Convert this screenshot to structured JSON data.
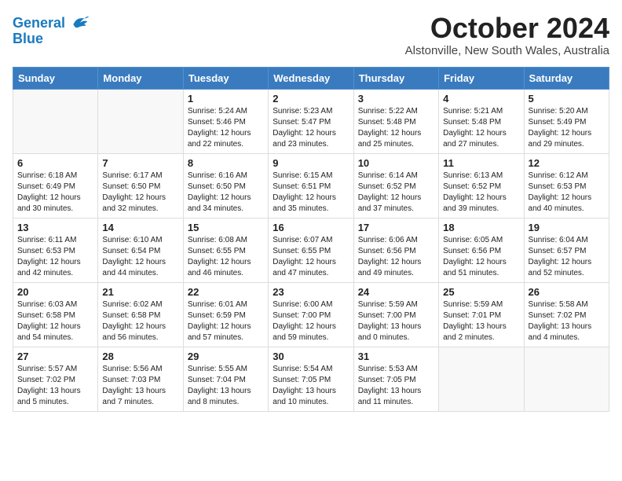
{
  "logo": {
    "line1": "General",
    "line2": "Blue"
  },
  "title": "October 2024",
  "subtitle": "Alstonville, New South Wales, Australia",
  "weekdays": [
    "Sunday",
    "Monday",
    "Tuesday",
    "Wednesday",
    "Thursday",
    "Friday",
    "Saturday"
  ],
  "weeks": [
    [
      {
        "day": "",
        "info": ""
      },
      {
        "day": "",
        "info": ""
      },
      {
        "day": "1",
        "info": "Sunrise: 5:24 AM\nSunset: 5:46 PM\nDaylight: 12 hours\nand 22 minutes."
      },
      {
        "day": "2",
        "info": "Sunrise: 5:23 AM\nSunset: 5:47 PM\nDaylight: 12 hours\nand 23 minutes."
      },
      {
        "day": "3",
        "info": "Sunrise: 5:22 AM\nSunset: 5:48 PM\nDaylight: 12 hours\nand 25 minutes."
      },
      {
        "day": "4",
        "info": "Sunrise: 5:21 AM\nSunset: 5:48 PM\nDaylight: 12 hours\nand 27 minutes."
      },
      {
        "day": "5",
        "info": "Sunrise: 5:20 AM\nSunset: 5:49 PM\nDaylight: 12 hours\nand 29 minutes."
      }
    ],
    [
      {
        "day": "6",
        "info": "Sunrise: 6:18 AM\nSunset: 6:49 PM\nDaylight: 12 hours\nand 30 minutes."
      },
      {
        "day": "7",
        "info": "Sunrise: 6:17 AM\nSunset: 6:50 PM\nDaylight: 12 hours\nand 32 minutes."
      },
      {
        "day": "8",
        "info": "Sunrise: 6:16 AM\nSunset: 6:50 PM\nDaylight: 12 hours\nand 34 minutes."
      },
      {
        "day": "9",
        "info": "Sunrise: 6:15 AM\nSunset: 6:51 PM\nDaylight: 12 hours\nand 35 minutes."
      },
      {
        "day": "10",
        "info": "Sunrise: 6:14 AM\nSunset: 6:52 PM\nDaylight: 12 hours\nand 37 minutes."
      },
      {
        "day": "11",
        "info": "Sunrise: 6:13 AM\nSunset: 6:52 PM\nDaylight: 12 hours\nand 39 minutes."
      },
      {
        "day": "12",
        "info": "Sunrise: 6:12 AM\nSunset: 6:53 PM\nDaylight: 12 hours\nand 40 minutes."
      }
    ],
    [
      {
        "day": "13",
        "info": "Sunrise: 6:11 AM\nSunset: 6:53 PM\nDaylight: 12 hours\nand 42 minutes."
      },
      {
        "day": "14",
        "info": "Sunrise: 6:10 AM\nSunset: 6:54 PM\nDaylight: 12 hours\nand 44 minutes."
      },
      {
        "day": "15",
        "info": "Sunrise: 6:08 AM\nSunset: 6:55 PM\nDaylight: 12 hours\nand 46 minutes."
      },
      {
        "day": "16",
        "info": "Sunrise: 6:07 AM\nSunset: 6:55 PM\nDaylight: 12 hours\nand 47 minutes."
      },
      {
        "day": "17",
        "info": "Sunrise: 6:06 AM\nSunset: 6:56 PM\nDaylight: 12 hours\nand 49 minutes."
      },
      {
        "day": "18",
        "info": "Sunrise: 6:05 AM\nSunset: 6:56 PM\nDaylight: 12 hours\nand 51 minutes."
      },
      {
        "day": "19",
        "info": "Sunrise: 6:04 AM\nSunset: 6:57 PM\nDaylight: 12 hours\nand 52 minutes."
      }
    ],
    [
      {
        "day": "20",
        "info": "Sunrise: 6:03 AM\nSunset: 6:58 PM\nDaylight: 12 hours\nand 54 minutes."
      },
      {
        "day": "21",
        "info": "Sunrise: 6:02 AM\nSunset: 6:58 PM\nDaylight: 12 hours\nand 56 minutes."
      },
      {
        "day": "22",
        "info": "Sunrise: 6:01 AM\nSunset: 6:59 PM\nDaylight: 12 hours\nand 57 minutes."
      },
      {
        "day": "23",
        "info": "Sunrise: 6:00 AM\nSunset: 7:00 PM\nDaylight: 12 hours\nand 59 minutes."
      },
      {
        "day": "24",
        "info": "Sunrise: 5:59 AM\nSunset: 7:00 PM\nDaylight: 13 hours\nand 0 minutes."
      },
      {
        "day": "25",
        "info": "Sunrise: 5:59 AM\nSunset: 7:01 PM\nDaylight: 13 hours\nand 2 minutes."
      },
      {
        "day": "26",
        "info": "Sunrise: 5:58 AM\nSunset: 7:02 PM\nDaylight: 13 hours\nand 4 minutes."
      }
    ],
    [
      {
        "day": "27",
        "info": "Sunrise: 5:57 AM\nSunset: 7:02 PM\nDaylight: 13 hours\nand 5 minutes."
      },
      {
        "day": "28",
        "info": "Sunrise: 5:56 AM\nSunset: 7:03 PM\nDaylight: 13 hours\nand 7 minutes."
      },
      {
        "day": "29",
        "info": "Sunrise: 5:55 AM\nSunset: 7:04 PM\nDaylight: 13 hours\nand 8 minutes."
      },
      {
        "day": "30",
        "info": "Sunrise: 5:54 AM\nSunset: 7:05 PM\nDaylight: 13 hours\nand 10 minutes."
      },
      {
        "day": "31",
        "info": "Sunrise: 5:53 AM\nSunset: 7:05 PM\nDaylight: 13 hours\nand 11 minutes."
      },
      {
        "day": "",
        "info": ""
      },
      {
        "day": "",
        "info": ""
      }
    ]
  ]
}
